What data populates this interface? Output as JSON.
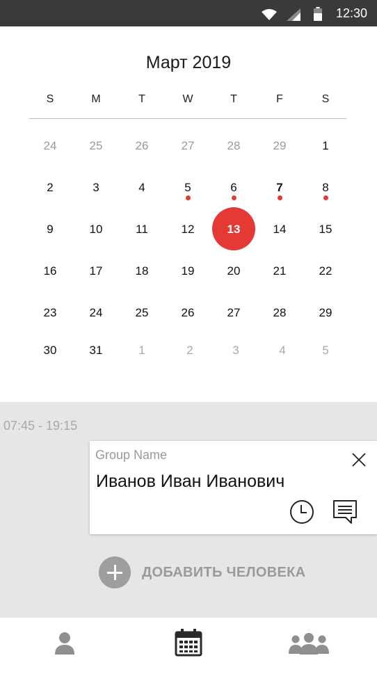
{
  "status_bar": {
    "time": "12:30",
    "icons": [
      "wifi-icon",
      "cell-signal-icon",
      "battery-icon"
    ]
  },
  "calendar": {
    "title": "Март 2019",
    "weekdays": [
      "S",
      "M",
      "T",
      "W",
      "T",
      "F",
      "S"
    ],
    "weeks": [
      [
        "24",
        "25",
        "26",
        "27",
        "28",
        "29",
        "1"
      ],
      [
        "2",
        "3",
        "4",
        "5",
        "6",
        "7",
        "8"
      ],
      [
        "9",
        "10",
        "11",
        "12",
        "13",
        "14",
        "15"
      ],
      [
        "16",
        "17",
        "18",
        "19",
        "20",
        "21",
        "22"
      ],
      [
        "23",
        "24",
        "25",
        "26",
        "27",
        "28",
        "29"
      ],
      [
        "30",
        "31",
        "1",
        "2",
        "3",
        "4",
        "5"
      ]
    ],
    "selected_day": "13",
    "days_with_events": [
      "5",
      "6",
      "7",
      "8"
    ],
    "bold_day": "7",
    "accent_color": "#e53935"
  },
  "schedule": {
    "time_range": "07:45 - 19:15",
    "card": {
      "group_name": "Group Name",
      "person_name": "Иванов Иван Иванович",
      "icons": [
        "close-icon",
        "clock-icon",
        "message-icon"
      ]
    },
    "add_person_label": "ДОБАВИТЬ ЧЕЛОВЕКА"
  },
  "bottom_nav": {
    "items": [
      "person-icon",
      "calendar-icon",
      "group-icon"
    ],
    "active": "calendar-icon"
  }
}
